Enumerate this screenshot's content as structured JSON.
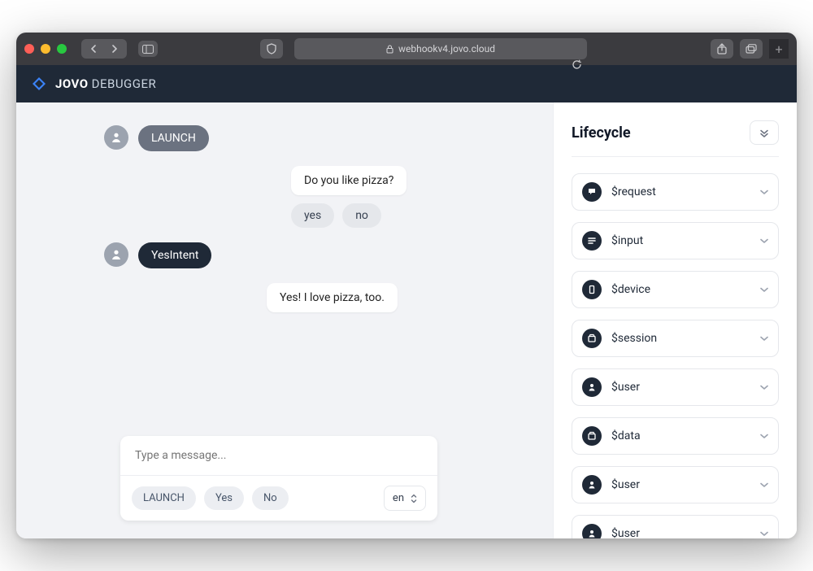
{
  "browser": {
    "url_host": "webhookv4.jovo.cloud"
  },
  "brand": {
    "name": "JOVO",
    "suffix": "DEBUGGER"
  },
  "chat": {
    "messages": [
      {
        "sender": "user",
        "variant": "grey",
        "text": "LAUNCH"
      },
      {
        "sender": "bot",
        "text": "Do you like pizza?",
        "quick_replies": [
          "yes",
          "no"
        ]
      },
      {
        "sender": "user",
        "variant": "dark",
        "text": "YesIntent"
      },
      {
        "sender": "bot",
        "text": "Yes! I love pizza, too."
      }
    ],
    "input_placeholder": "Type a message...",
    "suggestions": [
      "LAUNCH",
      "Yes",
      "No"
    ],
    "language": "en"
  },
  "sidebar": {
    "title": "Lifecycle",
    "items": [
      {
        "icon": "chat",
        "label": "$request"
      },
      {
        "icon": "lines",
        "label": "$input"
      },
      {
        "icon": "device",
        "label": "$device"
      },
      {
        "icon": "store",
        "label": "$session"
      },
      {
        "icon": "user",
        "label": "$user"
      },
      {
        "icon": "store",
        "label": "$data"
      },
      {
        "icon": "user",
        "label": "$user"
      },
      {
        "icon": "user",
        "label": "$user"
      }
    ]
  }
}
